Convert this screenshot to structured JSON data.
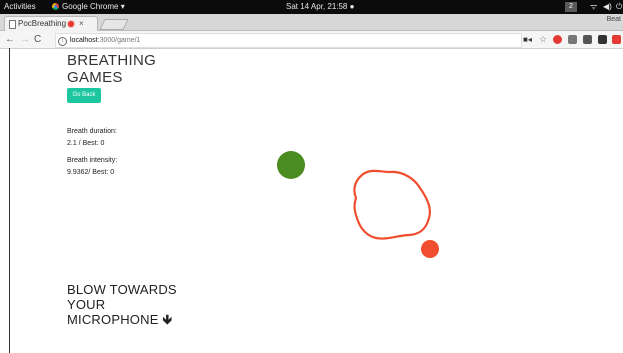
{
  "system_bar": {
    "activities": "Activities",
    "app_menu": "Google Chrome ▾",
    "clock": "Sat 14 Apr, 21:58 ●",
    "workspace": "2"
  },
  "browser": {
    "tab_title": "PocBreathing",
    "tab_close": "×",
    "profile": "Beat",
    "url_host": "localhost",
    "url_path": ":3000/game/1"
  },
  "page": {
    "title_line1": "BREATHING",
    "title_line2": "GAMES",
    "go_back_label": "Go Back",
    "breath_duration_label": "Breath duration:",
    "breath_duration_value": "2.1 / Best: 0",
    "breath_intensity_label": "Breath intensity:",
    "breath_intensity_value": "9.9362/ Best: 0",
    "instruction_line1": "BLOW TOWARDS",
    "instruction_line2": "YOUR",
    "instruction_line3": "MICROPHONE",
    "instruction_arrow": "🡻"
  },
  "game": {
    "player_color": "#4a8c1f",
    "target_color": "#f04e2e",
    "outline_color": "#f04e2e"
  }
}
